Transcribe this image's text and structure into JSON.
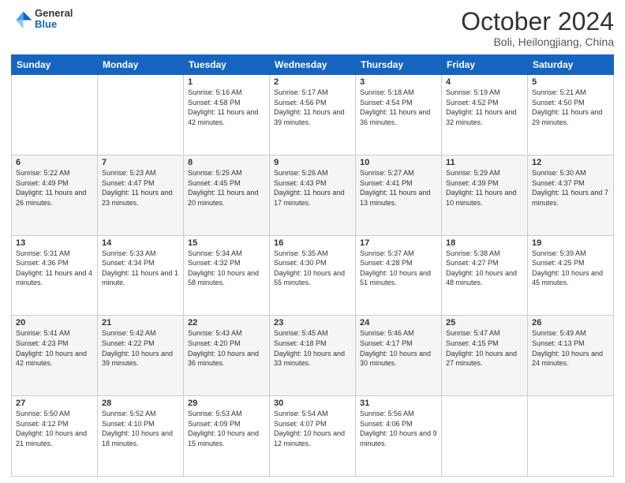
{
  "header": {
    "logo": {
      "general": "General",
      "blue": "Blue"
    },
    "title": "October 2024",
    "location": "Boli, Heilongjiang, China"
  },
  "weekdays": [
    "Sunday",
    "Monday",
    "Tuesday",
    "Wednesday",
    "Thursday",
    "Friday",
    "Saturday"
  ],
  "weeks": [
    [
      {
        "day": null,
        "sunrise": null,
        "sunset": null,
        "daylight": null
      },
      {
        "day": null,
        "sunrise": null,
        "sunset": null,
        "daylight": null
      },
      {
        "day": "1",
        "sunrise": "Sunrise: 5:16 AM",
        "sunset": "Sunset: 4:58 PM",
        "daylight": "Daylight: 11 hours and 42 minutes."
      },
      {
        "day": "2",
        "sunrise": "Sunrise: 5:17 AM",
        "sunset": "Sunset: 4:56 PM",
        "daylight": "Daylight: 11 hours and 39 minutes."
      },
      {
        "day": "3",
        "sunrise": "Sunrise: 5:18 AM",
        "sunset": "Sunset: 4:54 PM",
        "daylight": "Daylight: 11 hours and 36 minutes."
      },
      {
        "day": "4",
        "sunrise": "Sunrise: 5:19 AM",
        "sunset": "Sunset: 4:52 PM",
        "daylight": "Daylight: 11 hours and 32 minutes."
      },
      {
        "day": "5",
        "sunrise": "Sunrise: 5:21 AM",
        "sunset": "Sunset: 4:50 PM",
        "daylight": "Daylight: 11 hours and 29 minutes."
      }
    ],
    [
      {
        "day": "6",
        "sunrise": "Sunrise: 5:22 AM",
        "sunset": "Sunset: 4:49 PM",
        "daylight": "Daylight: 11 hours and 26 minutes."
      },
      {
        "day": "7",
        "sunrise": "Sunrise: 5:23 AM",
        "sunset": "Sunset: 4:47 PM",
        "daylight": "Daylight: 11 hours and 23 minutes."
      },
      {
        "day": "8",
        "sunrise": "Sunrise: 5:25 AM",
        "sunset": "Sunset: 4:45 PM",
        "daylight": "Daylight: 11 hours and 20 minutes."
      },
      {
        "day": "9",
        "sunrise": "Sunrise: 5:26 AM",
        "sunset": "Sunset: 4:43 PM",
        "daylight": "Daylight: 11 hours and 17 minutes."
      },
      {
        "day": "10",
        "sunrise": "Sunrise: 5:27 AM",
        "sunset": "Sunset: 4:41 PM",
        "daylight": "Daylight: 11 hours and 13 minutes."
      },
      {
        "day": "11",
        "sunrise": "Sunrise: 5:29 AM",
        "sunset": "Sunset: 4:39 PM",
        "daylight": "Daylight: 11 hours and 10 minutes."
      },
      {
        "day": "12",
        "sunrise": "Sunrise: 5:30 AM",
        "sunset": "Sunset: 4:37 PM",
        "daylight": "Daylight: 11 hours and 7 minutes."
      }
    ],
    [
      {
        "day": "13",
        "sunrise": "Sunrise: 5:31 AM",
        "sunset": "Sunset: 4:36 PM",
        "daylight": "Daylight: 11 hours and 4 minutes."
      },
      {
        "day": "14",
        "sunrise": "Sunrise: 5:33 AM",
        "sunset": "Sunset: 4:34 PM",
        "daylight": "Daylight: 11 hours and 1 minute."
      },
      {
        "day": "15",
        "sunrise": "Sunrise: 5:34 AM",
        "sunset": "Sunset: 4:32 PM",
        "daylight": "Daylight: 10 hours and 58 minutes."
      },
      {
        "day": "16",
        "sunrise": "Sunrise: 5:35 AM",
        "sunset": "Sunset: 4:30 PM",
        "daylight": "Daylight: 10 hours and 55 minutes."
      },
      {
        "day": "17",
        "sunrise": "Sunrise: 5:37 AM",
        "sunset": "Sunset: 4:28 PM",
        "daylight": "Daylight: 10 hours and 51 minutes."
      },
      {
        "day": "18",
        "sunrise": "Sunrise: 5:38 AM",
        "sunset": "Sunset: 4:27 PM",
        "daylight": "Daylight: 10 hours and 48 minutes."
      },
      {
        "day": "19",
        "sunrise": "Sunrise: 5:39 AM",
        "sunset": "Sunset: 4:25 PM",
        "daylight": "Daylight: 10 hours and 45 minutes."
      }
    ],
    [
      {
        "day": "20",
        "sunrise": "Sunrise: 5:41 AM",
        "sunset": "Sunset: 4:23 PM",
        "daylight": "Daylight: 10 hours and 42 minutes."
      },
      {
        "day": "21",
        "sunrise": "Sunrise: 5:42 AM",
        "sunset": "Sunset: 4:22 PM",
        "daylight": "Daylight: 10 hours and 39 minutes."
      },
      {
        "day": "22",
        "sunrise": "Sunrise: 5:43 AM",
        "sunset": "Sunset: 4:20 PM",
        "daylight": "Daylight: 10 hours and 36 minutes."
      },
      {
        "day": "23",
        "sunrise": "Sunrise: 5:45 AM",
        "sunset": "Sunset: 4:18 PM",
        "daylight": "Daylight: 10 hours and 33 minutes."
      },
      {
        "day": "24",
        "sunrise": "Sunrise: 5:46 AM",
        "sunset": "Sunset: 4:17 PM",
        "daylight": "Daylight: 10 hours and 30 minutes."
      },
      {
        "day": "25",
        "sunrise": "Sunrise: 5:47 AM",
        "sunset": "Sunset: 4:15 PM",
        "daylight": "Daylight: 10 hours and 27 minutes."
      },
      {
        "day": "26",
        "sunrise": "Sunrise: 5:49 AM",
        "sunset": "Sunset: 4:13 PM",
        "daylight": "Daylight: 10 hours and 24 minutes."
      }
    ],
    [
      {
        "day": "27",
        "sunrise": "Sunrise: 5:50 AM",
        "sunset": "Sunset: 4:12 PM",
        "daylight": "Daylight: 10 hours and 21 minutes."
      },
      {
        "day": "28",
        "sunrise": "Sunrise: 5:52 AM",
        "sunset": "Sunset: 4:10 PM",
        "daylight": "Daylight: 10 hours and 18 minutes."
      },
      {
        "day": "29",
        "sunrise": "Sunrise: 5:53 AM",
        "sunset": "Sunset: 4:09 PM",
        "daylight": "Daylight: 10 hours and 15 minutes."
      },
      {
        "day": "30",
        "sunrise": "Sunrise: 5:54 AM",
        "sunset": "Sunset: 4:07 PM",
        "daylight": "Daylight: 10 hours and 12 minutes."
      },
      {
        "day": "31",
        "sunrise": "Sunrise: 5:56 AM",
        "sunset": "Sunset: 4:06 PM",
        "daylight": "Daylight: 10 hours and 9 minutes."
      },
      {
        "day": null,
        "sunrise": null,
        "sunset": null,
        "daylight": null
      },
      {
        "day": null,
        "sunrise": null,
        "sunset": null,
        "daylight": null
      }
    ]
  ]
}
